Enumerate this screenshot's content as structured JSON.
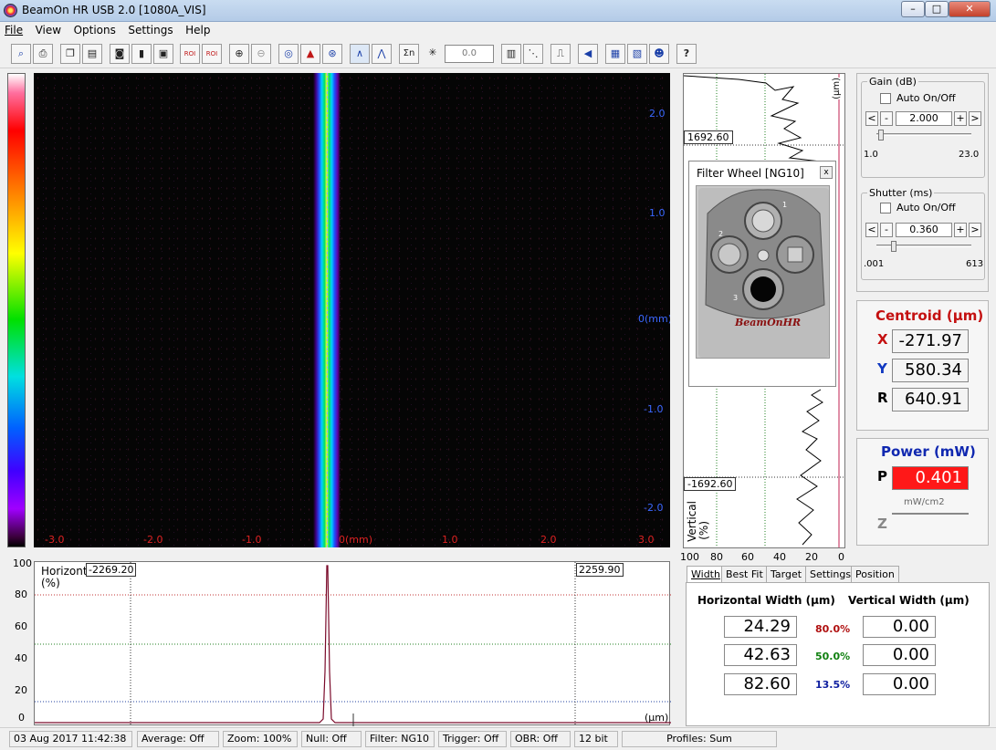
{
  "window": {
    "title": "BeamOn HR USB 2.0  [1080A_VIS]",
    "min_label": "–",
    "max_label": "□",
    "close_label": "✕"
  },
  "menu": [
    "File",
    "View",
    "Options",
    "Settings",
    "Help"
  ],
  "toolbar": {
    "zoom_value": "0.0",
    "help_label": "?",
    "roi_label": "ROI",
    "sigma_label": "Σn"
  },
  "image": {
    "y_ticks": [
      "2.0",
      "1.0",
      "0(mm)",
      "-1.0",
      "-2.0"
    ],
    "x_ticks": [
      "-3.0",
      "-2.0",
      "-1.0",
      "0(mm)",
      "1.0",
      "2.0",
      "3.0"
    ]
  },
  "horizontal_profile": {
    "label": "Horizontal",
    "unit": "(%)",
    "y_ticks": [
      "100",
      "80",
      "60",
      "40",
      "20",
      "0"
    ],
    "left_marker": "-2269.20",
    "right_marker": "2259.90",
    "x_unit": "(µm)"
  },
  "vertical_profile": {
    "unit": "(µm)",
    "label": "Vertical",
    "pct": "(%)",
    "top_marker": "1692.60",
    "bottom_marker": "-1692.60",
    "x_ticks": [
      "100",
      "80",
      "60",
      "40",
      "20",
      "0"
    ]
  },
  "filter_wheel": {
    "title": "Filter Wheel  [NG10]",
    "close": "x",
    "brand": "BeamOnHR",
    "slot_labels": [
      "1",
      "2",
      "3"
    ]
  },
  "gain": {
    "title": "Gain (dB)",
    "auto_label": "Auto On/Off",
    "value": "2.000",
    "min": "1.0",
    "max": "23.0",
    "level_fraction": 0.045
  },
  "shutter": {
    "title": "Shutter (ms)",
    "auto_label": "Auto On/Off",
    "value": "0.360",
    "min": ".001",
    "max": "613",
    "level_fraction": 0.18
  },
  "centroid": {
    "title": "Centroid (µm)",
    "x_label": "X",
    "x_value": "-271.97",
    "y_label": "Y",
    "y_value": "580.34",
    "r_label": "R",
    "r_value": "640.91"
  },
  "power": {
    "title": "Power (mW)",
    "p_label": "P",
    "p_value": "0.401",
    "unit2": "mW/cm2",
    "z_label": "Z",
    "z_value": ""
  },
  "tabs": [
    "Width",
    "Best Fit",
    "Target",
    "Settings",
    "Position"
  ],
  "width_tab": {
    "h_title": "Horizontal Width (µm)",
    "v_title": "Vertical Width (µm)",
    "rows": [
      {
        "h": "24.29",
        "pct": "80.0%",
        "v": "0.00",
        "color": "#b01010"
      },
      {
        "h": "42.63",
        "pct": "50.0%",
        "v": "0.00",
        "color": "#108010"
      },
      {
        "h": "82.60",
        "pct": "13.5%",
        "v": "0.00",
        "color": "#1020a0"
      }
    ]
  },
  "status": {
    "datetime": "03 Aug 2017   11:42:38",
    "average": "Average: Off",
    "zoom": "Zoom: 100%",
    "null": "Null: Off",
    "filter": "Filter: NG10",
    "trigger": "Trigger: Off",
    "obr": "OBR: Off",
    "bits": "12 bit",
    "profiles": "Profiles: Sum"
  }
}
